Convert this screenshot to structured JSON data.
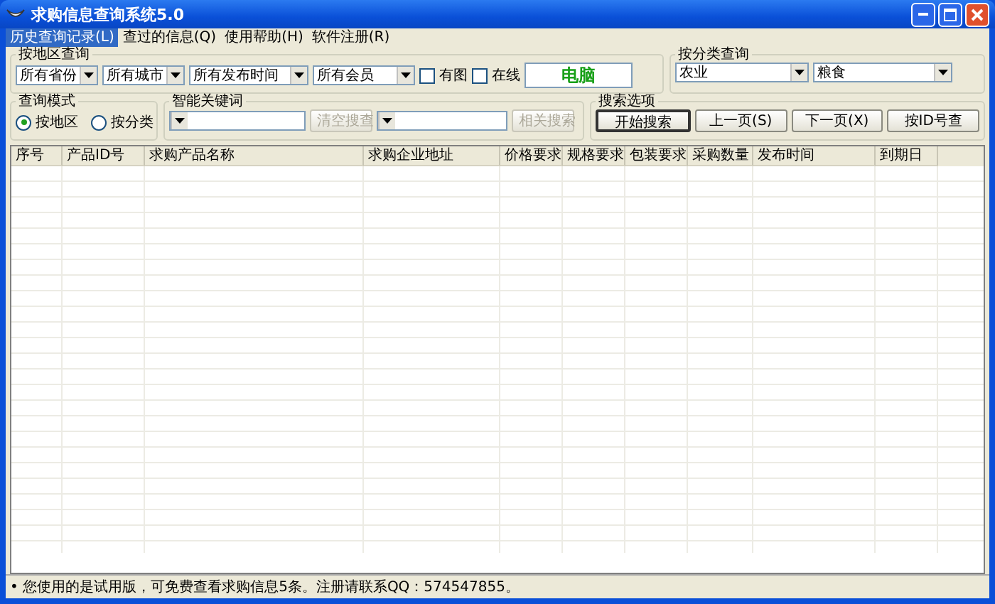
{
  "window": {
    "title": "求购信息查询系统5.0"
  },
  "menu": [
    {
      "label": "历史查询记录(L)",
      "selected": true
    },
    {
      "label": "查过的信息(Q)",
      "selected": false
    },
    {
      "label": "使用帮助(H)",
      "selected": false
    },
    {
      "label": "软件注册(R)",
      "selected": false
    }
  ],
  "region_group": {
    "title": "按地区查询",
    "dropdowns": [
      "所有省份",
      "所有城市",
      "所有发布时间",
      "所有会员"
    ],
    "checkboxes": [
      {
        "label": "有图",
        "checked": false
      },
      {
        "label": "在线",
        "checked": false
      }
    ],
    "display": "电脑"
  },
  "category_group": {
    "title": "按分类查询",
    "dropdowns": [
      "农业",
      "粮食"
    ]
  },
  "mode_group": {
    "title": "查询模式",
    "radios": [
      {
        "label": "按地区",
        "selected": true
      },
      {
        "label": "按分类",
        "selected": false
      }
    ]
  },
  "keyword_group": {
    "title": "智能关键词",
    "items": [
      {
        "kind": "combo"
      },
      {
        "kind": "button",
        "label": "清空搜查",
        "disabled": true
      },
      {
        "kind": "combo"
      },
      {
        "kind": "button",
        "label": "相关搜索",
        "disabled": true
      }
    ]
  },
  "search_group": {
    "title": "搜索选项",
    "buttons": [
      {
        "label": "开始搜索",
        "default": true
      },
      {
        "label": "上一页(S)",
        "default": false
      },
      {
        "label": "下一页(X)",
        "default": false
      },
      {
        "label": "按ID号查",
        "default": false
      }
    ]
  },
  "table": {
    "columns": [
      "序号",
      "产品ID号",
      "求购产品名称",
      "求购企业地址",
      "价格要求",
      "规格要求",
      "包装要求",
      "采购数量",
      "发布时间",
      "到期日"
    ]
  },
  "status_bar": "• 您使用的是试用版，可免费查看求购信息5条。注册请联系QQ：574547855。"
}
